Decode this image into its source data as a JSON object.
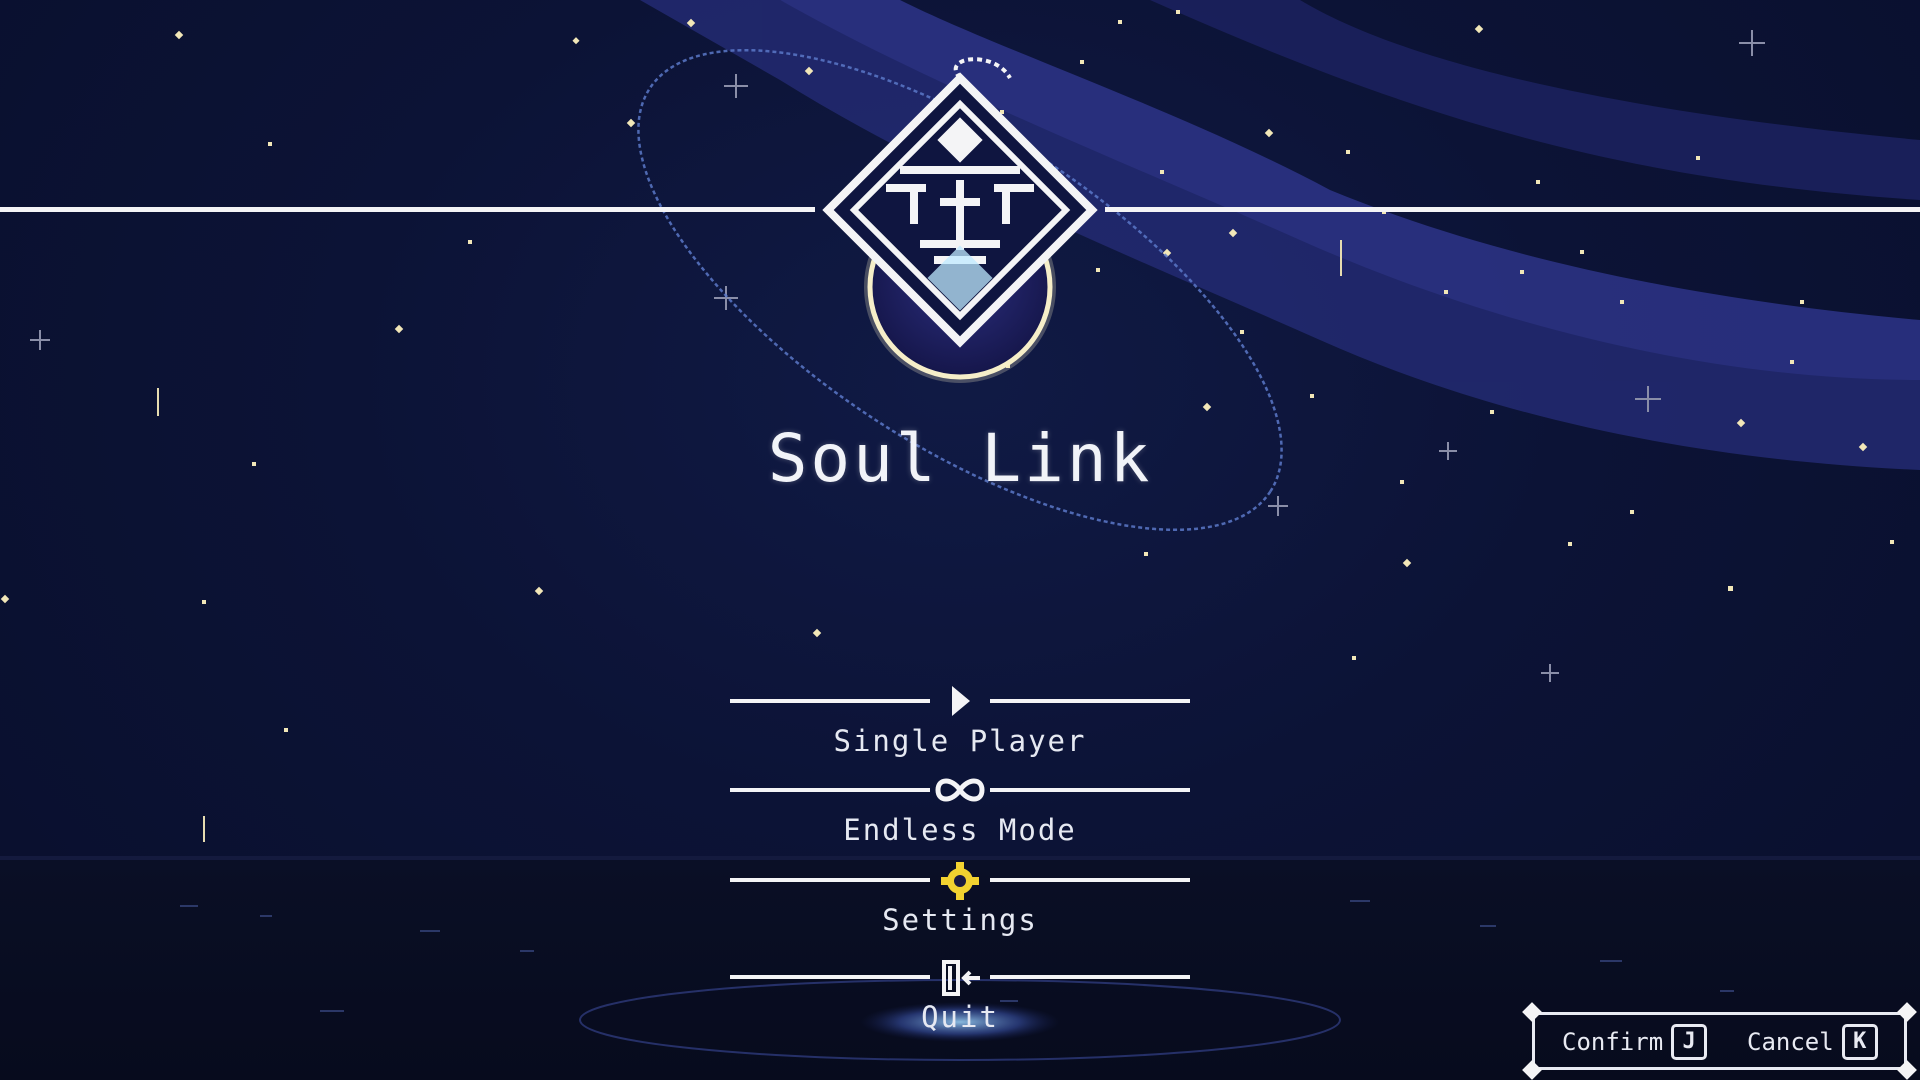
{
  "game": {
    "title": "Soul Link"
  },
  "menu": {
    "items": [
      {
        "label": "Single Player",
        "icon": "play-arrow-icon"
      },
      {
        "label": "Endless Mode",
        "icon": "infinity-icon"
      },
      {
        "label": "Settings",
        "icon": "gear-icon",
        "active": true
      },
      {
        "label": "Quit",
        "icon": "exit-door-icon"
      }
    ]
  },
  "hints": {
    "confirm_label": "Confirm",
    "confirm_key": "J",
    "cancel_label": "Cancel",
    "cancel_key": "K"
  },
  "colors": {
    "background": "#0b1130",
    "nebula": "#2a2f7a",
    "star": "#f2e7b8",
    "text": "#e6e9f2",
    "active_icon": "#f2d230",
    "emblem_glow": "#8fd3ff"
  }
}
